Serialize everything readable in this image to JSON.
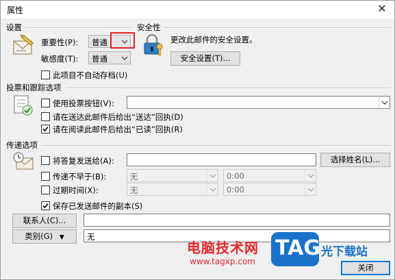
{
  "window": {
    "title": "属性"
  },
  "settings": {
    "heading": "设置",
    "importance_label": "重要性(P):",
    "importance_value": "普通",
    "sensitivity_label": "敏感度(T):",
    "sensitivity_value": "普通",
    "noautoarchive_label": "此项目不自动存档(U)"
  },
  "security": {
    "heading": "安全性",
    "description": "更改此邮件的安全设置。",
    "button_label": "安全设置(T)..."
  },
  "voting": {
    "heading": "投票和跟踪选项",
    "use_voting_label": "使用投票按钮(V):",
    "delivery_receipt_label": "请在送达此邮件后给出“送达”回执(D)",
    "read_receipt_label": "请在阅读此邮件后给出“已读”回执(R)",
    "read_receipt_checked": true
  },
  "delivery": {
    "heading": "传递选项",
    "reply_to_label": "将答复发送给(A):",
    "select_names_label": "选择姓名(L)...",
    "defer_label": "传递不早于(B):",
    "defer_date": "无",
    "defer_time": "0:00",
    "expires_label": "过期时间(X):",
    "expires_date": "无",
    "expires_time": "0:00",
    "save_copy_label": "保存已发送邮件的副本(S)",
    "save_copy_checked": true
  },
  "contacts": {
    "button_label": "联系人(C)..."
  },
  "categories": {
    "button_label": "类别(G)",
    "value": "无"
  },
  "footer": {
    "close_label": "关闭"
  },
  "watermark": {
    "site_name": "电脑技术网",
    "site_url": "www.tagxp.com",
    "logo_text": "TAG",
    "brand_text": "光下载站"
  },
  "colors": {
    "accent": "#0078d7",
    "highlight_box": "#e02020",
    "watermark_red": "#e8262b",
    "watermark_blue": "#1a73c9"
  }
}
